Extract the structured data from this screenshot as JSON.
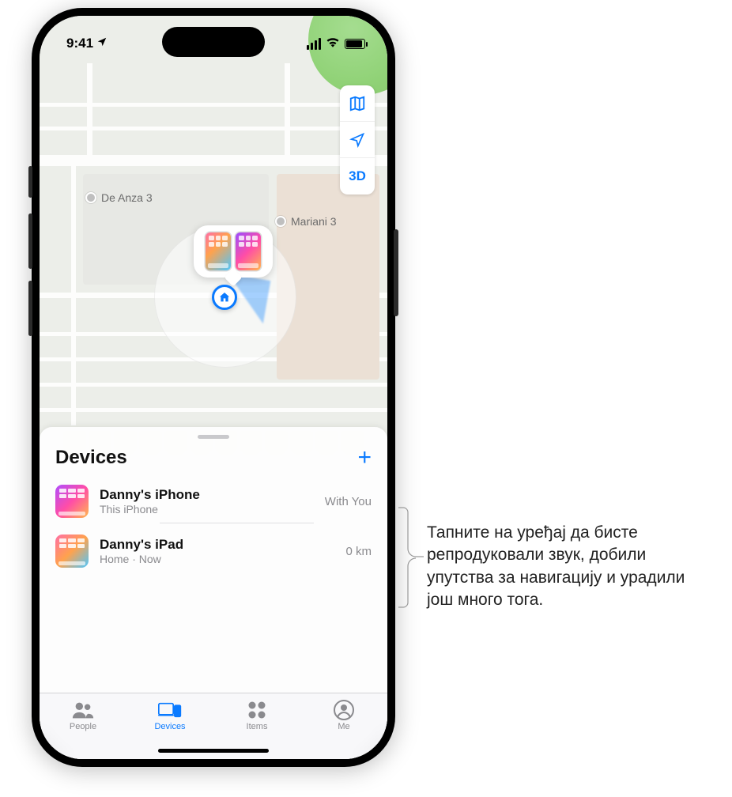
{
  "status_bar": {
    "time": "9:41",
    "location_arrow": "location-arrow-icon",
    "signal": 4,
    "wifi": true,
    "battery_pct": 100
  },
  "map": {
    "poi_labels": {
      "left": "De Anza 3",
      "right": "Mariani 3"
    },
    "controls": {
      "map_mode": "map-icon",
      "recenter": "location-arrow-icon",
      "three_d": "3D"
    },
    "home_pin": "home-icon",
    "bubble_devices": [
      "ipad",
      "iphone"
    ]
  },
  "sheet": {
    "title": "Devices",
    "add_label": "+",
    "devices": [
      {
        "name": "Danny's iPhone",
        "subtitle": "This iPhone",
        "meta": "With You",
        "thumb": "iphone"
      },
      {
        "name": "Danny's iPad",
        "subtitle": "Home · Now",
        "meta": "0 km",
        "thumb": "ipad"
      }
    ]
  },
  "tabbar": {
    "items": [
      {
        "label": "People",
        "icon": "people-icon",
        "active": false
      },
      {
        "label": "Devices",
        "icon": "devices-icon",
        "active": true
      },
      {
        "label": "Items",
        "icon": "items-icon",
        "active": false
      },
      {
        "label": "Me",
        "icon": "me-icon",
        "active": false
      }
    ]
  },
  "callout": {
    "text": "Тапните на уређај да бисте репродуковали звук, добили упутства за навигацију и урадили још много тога."
  }
}
